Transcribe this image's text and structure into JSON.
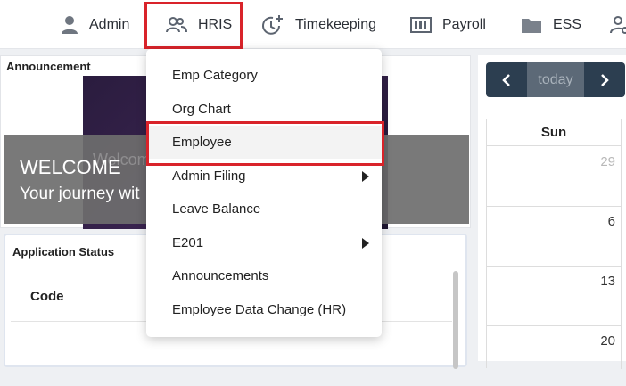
{
  "nav": {
    "items": [
      {
        "label": "Admin",
        "icon": "person-icon"
      },
      {
        "label": "HRIS",
        "icon": "people-icon"
      },
      {
        "label": "Timekeeping",
        "icon": "clock-plus-icon"
      },
      {
        "label": "Payroll",
        "icon": "payroll-icon"
      },
      {
        "label": "ESS",
        "icon": "folder-icon"
      }
    ],
    "highlighted": "HRIS"
  },
  "announcement": {
    "title": "Announcement",
    "banner_ghost": "Welcome",
    "banner_heading": "WELCOME",
    "banner_subtext": "Your journey wit"
  },
  "application_status": {
    "title": "Application Status",
    "columns": [
      "Code"
    ]
  },
  "calendar": {
    "today_label": "today",
    "day_header": "Sun",
    "dates": [
      {
        "day": "29",
        "muted": true
      },
      {
        "day": "6",
        "muted": false
      },
      {
        "day": "13",
        "muted": false
      },
      {
        "day": "20",
        "muted": false
      }
    ]
  },
  "dropdown": {
    "items": [
      {
        "label": "Emp Category",
        "submenu": false
      },
      {
        "label": "Org Chart",
        "submenu": false
      },
      {
        "label": "Employee",
        "submenu": false,
        "active": true
      },
      {
        "label": "Admin Filing",
        "submenu": true
      },
      {
        "label": "Leave Balance",
        "submenu": false
      },
      {
        "label": "E201",
        "submenu": true
      },
      {
        "label": "Announcements",
        "submenu": false
      },
      {
        "label": "Employee Data Change (HR)",
        "submenu": false
      }
    ]
  },
  "colors": {
    "highlight": "#d9232a",
    "calendar_button": "#2c3e50",
    "today_button": "#5c6977"
  }
}
